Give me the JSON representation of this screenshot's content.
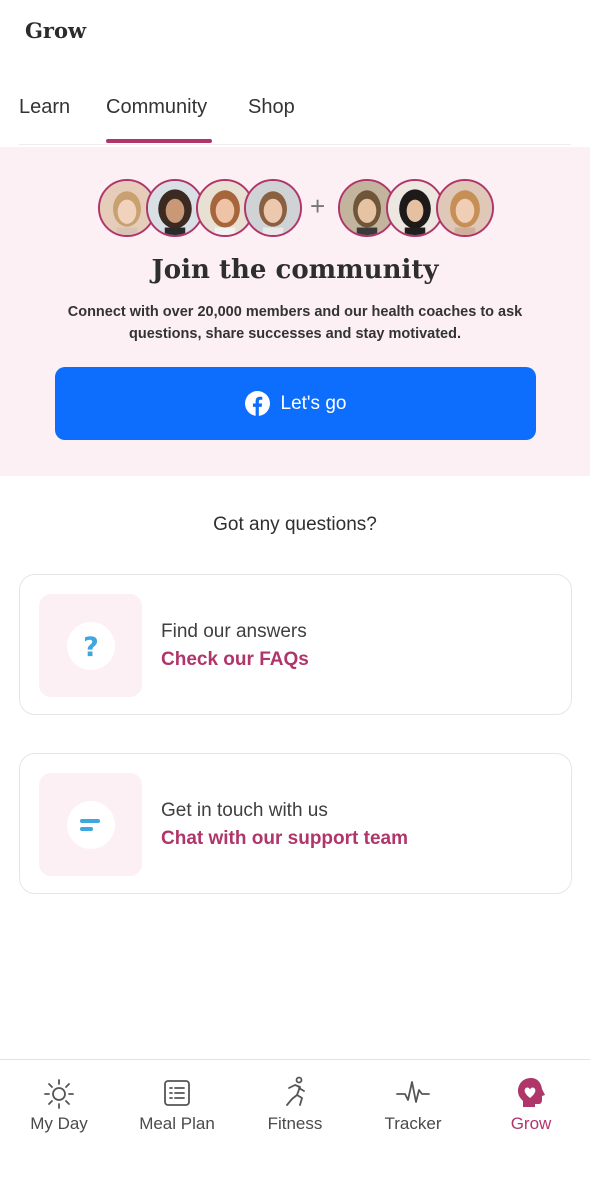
{
  "header": {
    "title": "Grow"
  },
  "tabs": [
    {
      "label": "Learn"
    },
    {
      "label": "Community"
    },
    {
      "label": "Shop"
    }
  ],
  "community": {
    "title": "Join the community",
    "text": "Connect with over 20,000 members and our health coaches to ask questions, share successes and stay motivated.",
    "plus": "+",
    "button_label": "Let's go"
  },
  "questions": {
    "title": "Got any questions?",
    "cards": [
      {
        "title": "Find our answers",
        "link": "Check our FAQs",
        "icon": "question-icon"
      },
      {
        "title": "Get in touch with us",
        "link": "Chat with our support team",
        "icon": "chat-icon"
      }
    ]
  },
  "bottom_nav": [
    {
      "label": "My Day",
      "icon": "sun-icon"
    },
    {
      "label": "Meal Plan",
      "icon": "meal-plan-icon"
    },
    {
      "label": "Fitness",
      "icon": "runner-icon"
    },
    {
      "label": "Tracker",
      "icon": "pulse-icon"
    },
    {
      "label": "Grow",
      "icon": "heart-head-icon",
      "active": true
    }
  ],
  "colors": {
    "accent": "#b0356a",
    "facebook": "#0d6efd",
    "hero_bg": "#fcf0f4",
    "info_blue": "#3ea6e0"
  }
}
